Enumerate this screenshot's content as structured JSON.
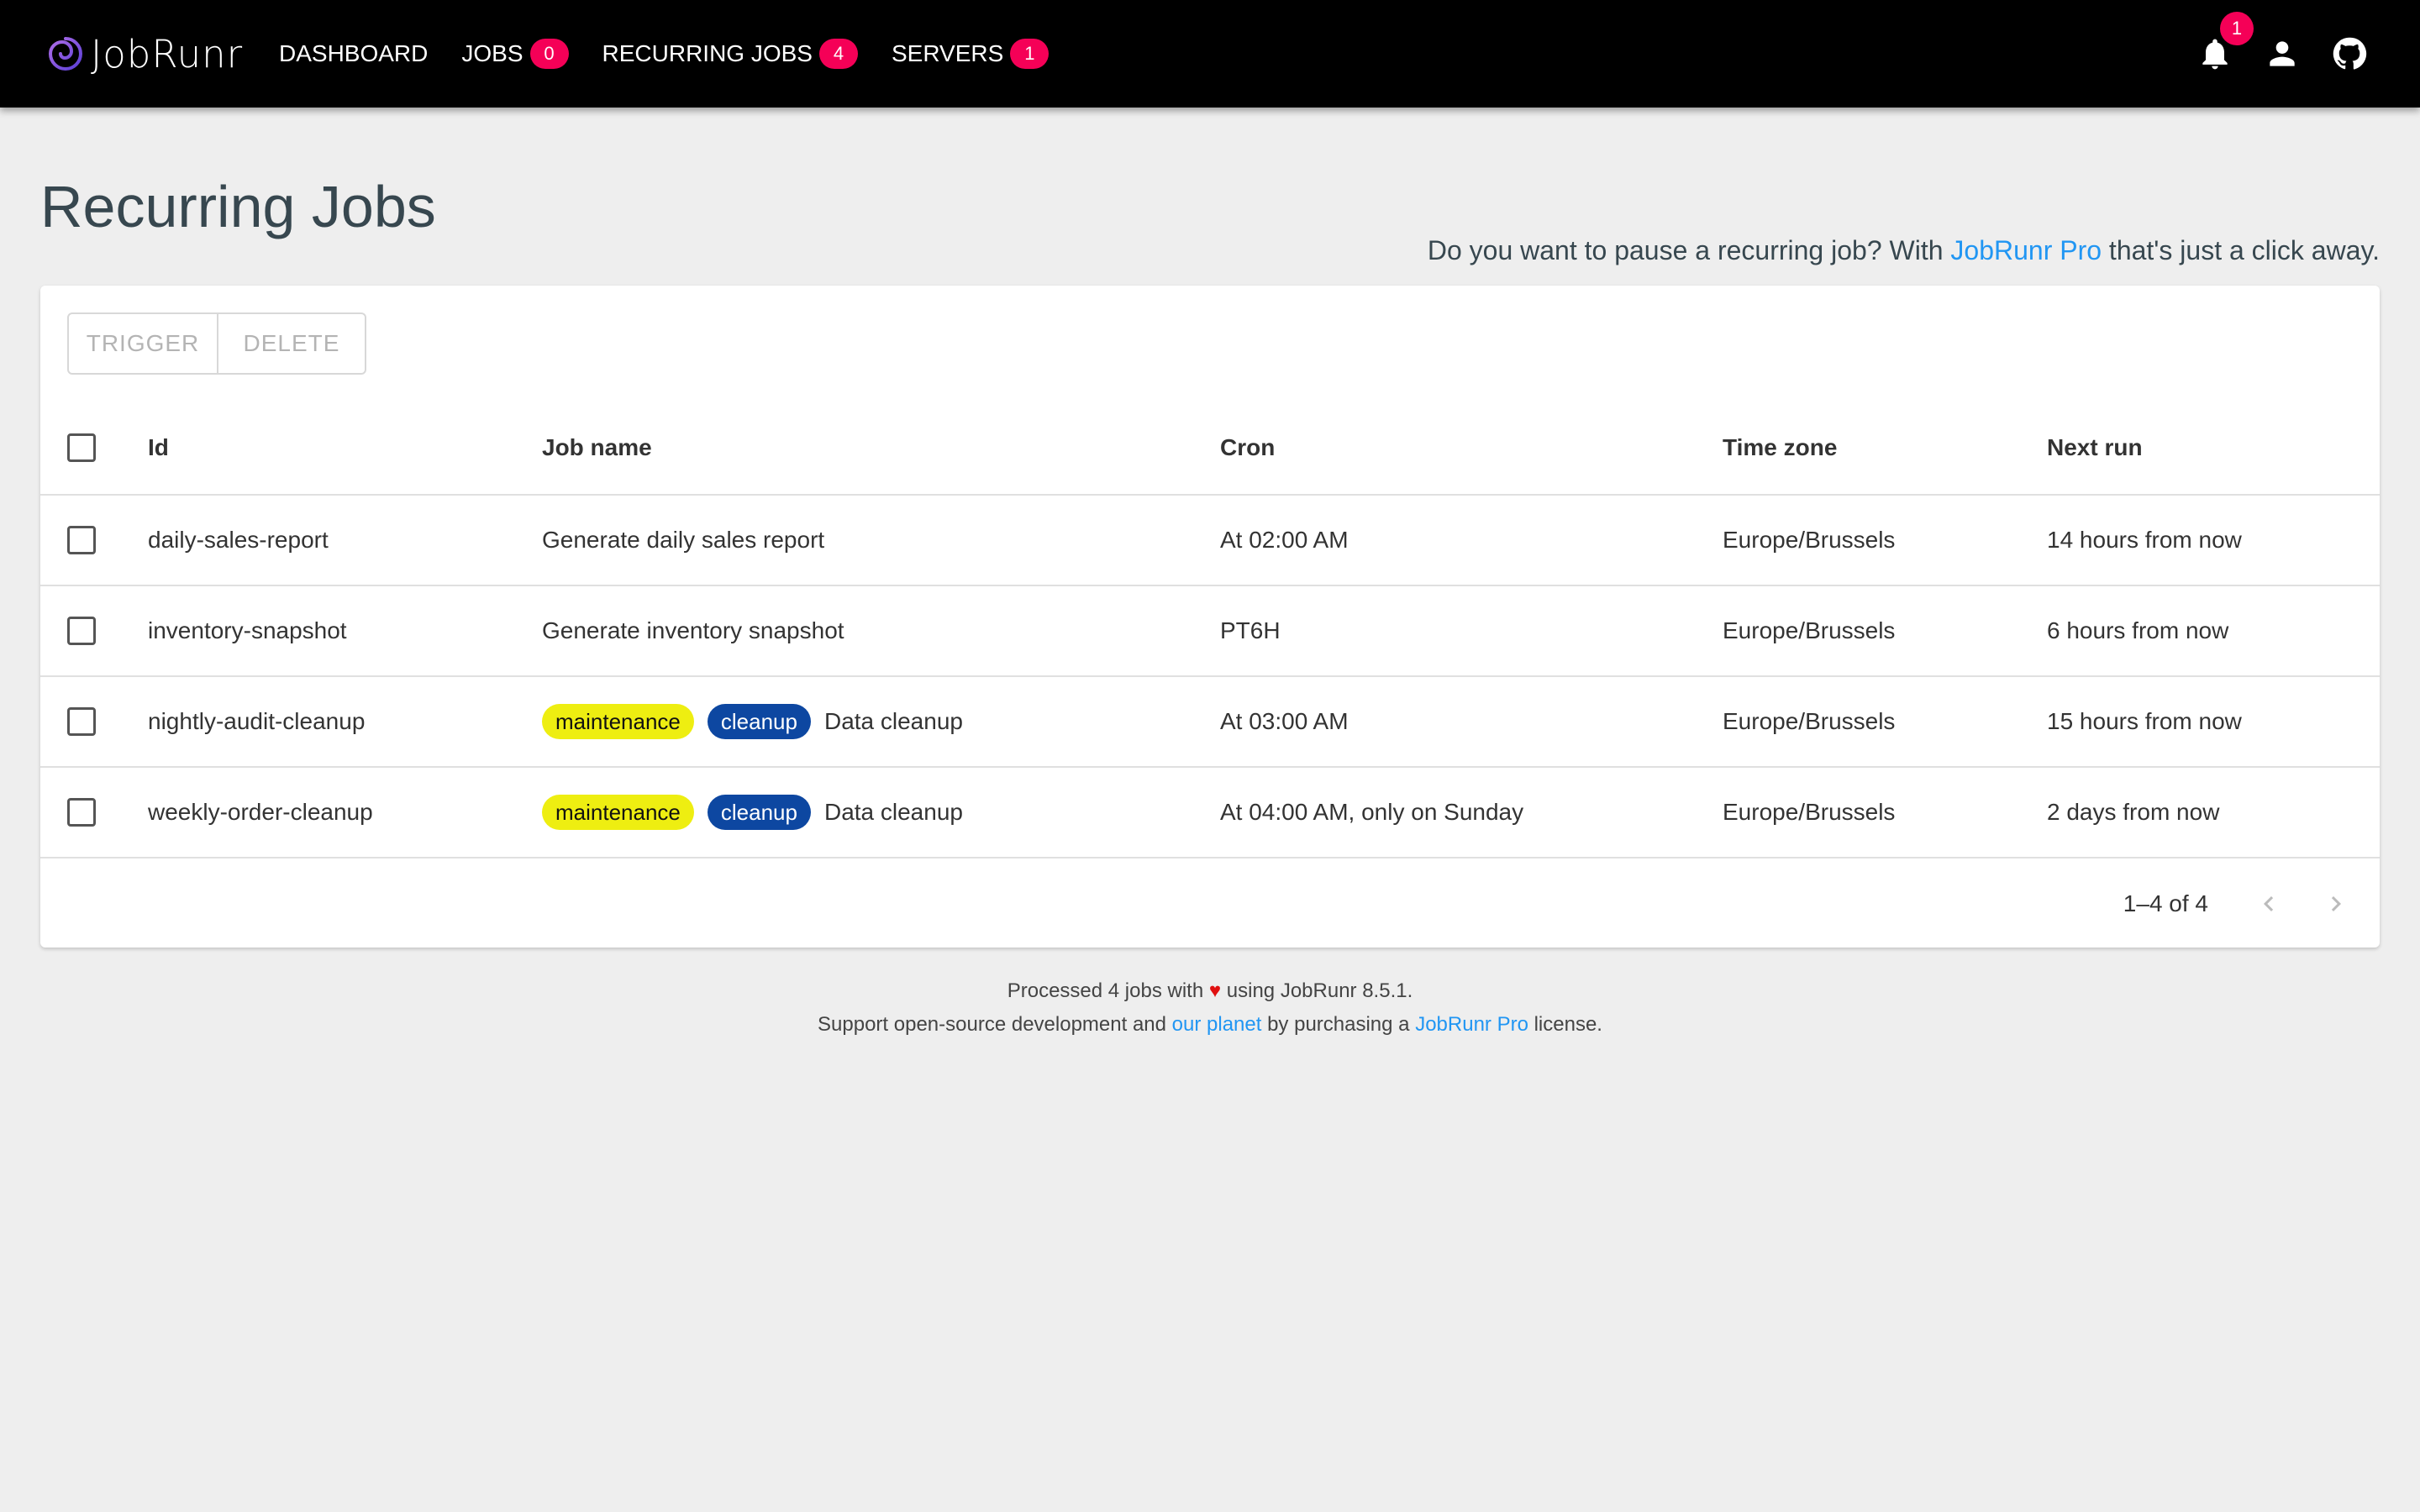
{
  "app": {
    "logo_text": "JobRunr"
  },
  "nav": {
    "items": [
      {
        "label": "DASHBOARD",
        "badge": ""
      },
      {
        "label": "JOBS",
        "badge": "0"
      },
      {
        "label": "RECURRING JOBS",
        "badge": "4"
      },
      {
        "label": "SERVERS",
        "badge": "1"
      }
    ],
    "notifications_badge": "1"
  },
  "page": {
    "title": "Recurring Jobs",
    "promo_prefix": "Do you want to pause a recurring job? With ",
    "promo_link": "JobRunr Pro",
    "promo_suffix": " that's just a click away."
  },
  "toolbar": {
    "trigger_label": "TRIGGER",
    "delete_label": "DELETE"
  },
  "table": {
    "headers": {
      "id": "Id",
      "name": "Job name",
      "cron": "Cron",
      "timezone": "Time zone",
      "next_run": "Next run"
    },
    "rows": [
      {
        "id": "daily-sales-report",
        "tags": [],
        "name": "Generate daily sales report",
        "cron": "At 02:00 AM",
        "timezone": "Europe/Brussels",
        "next_run": "14 hours from now"
      },
      {
        "id": "inventory-snapshot",
        "tags": [],
        "name": "Generate inventory snapshot",
        "cron": "PT6H",
        "timezone": "Europe/Brussels",
        "next_run": "6 hours from now"
      },
      {
        "id": "nightly-audit-cleanup",
        "tags": [
          "maintenance",
          "cleanup"
        ],
        "name": "Data cleanup",
        "cron": "At 03:00 AM",
        "timezone": "Europe/Brussels",
        "next_run": "15 hours from now"
      },
      {
        "id": "weekly-order-cleanup",
        "tags": [
          "maintenance",
          "cleanup"
        ],
        "name": "Data cleanup",
        "cron": "At 04:00 AM, only on Sunday",
        "timezone": "Europe/Brussels",
        "next_run": "2 days from now"
      }
    ],
    "tag_colors": {
      "maintenance": "#eeee11",
      "cleanup": "#0d47a1"
    }
  },
  "pagination": {
    "range_text": "1–4 of 4"
  },
  "footer": {
    "line1_prefix": "Processed 4 jobs with ",
    "heart": "♥",
    "line1_suffix": " using JobRunr 8.5.1.",
    "line2_prefix": "Support open-source development and ",
    "line2_link1": "our planet",
    "line2_middle": " by purchasing a ",
    "line2_link2": "JobRunr Pro",
    "line2_suffix": " license."
  },
  "colors": {
    "accent": "#f50057",
    "link": "#2196f3",
    "topbar": "#000000",
    "background": "#eeeeee"
  },
  "icons": [
    "jobrunr-logo-icon",
    "bell-icon",
    "account-icon",
    "github-icon",
    "chevron-left-icon",
    "chevron-right-icon"
  ]
}
